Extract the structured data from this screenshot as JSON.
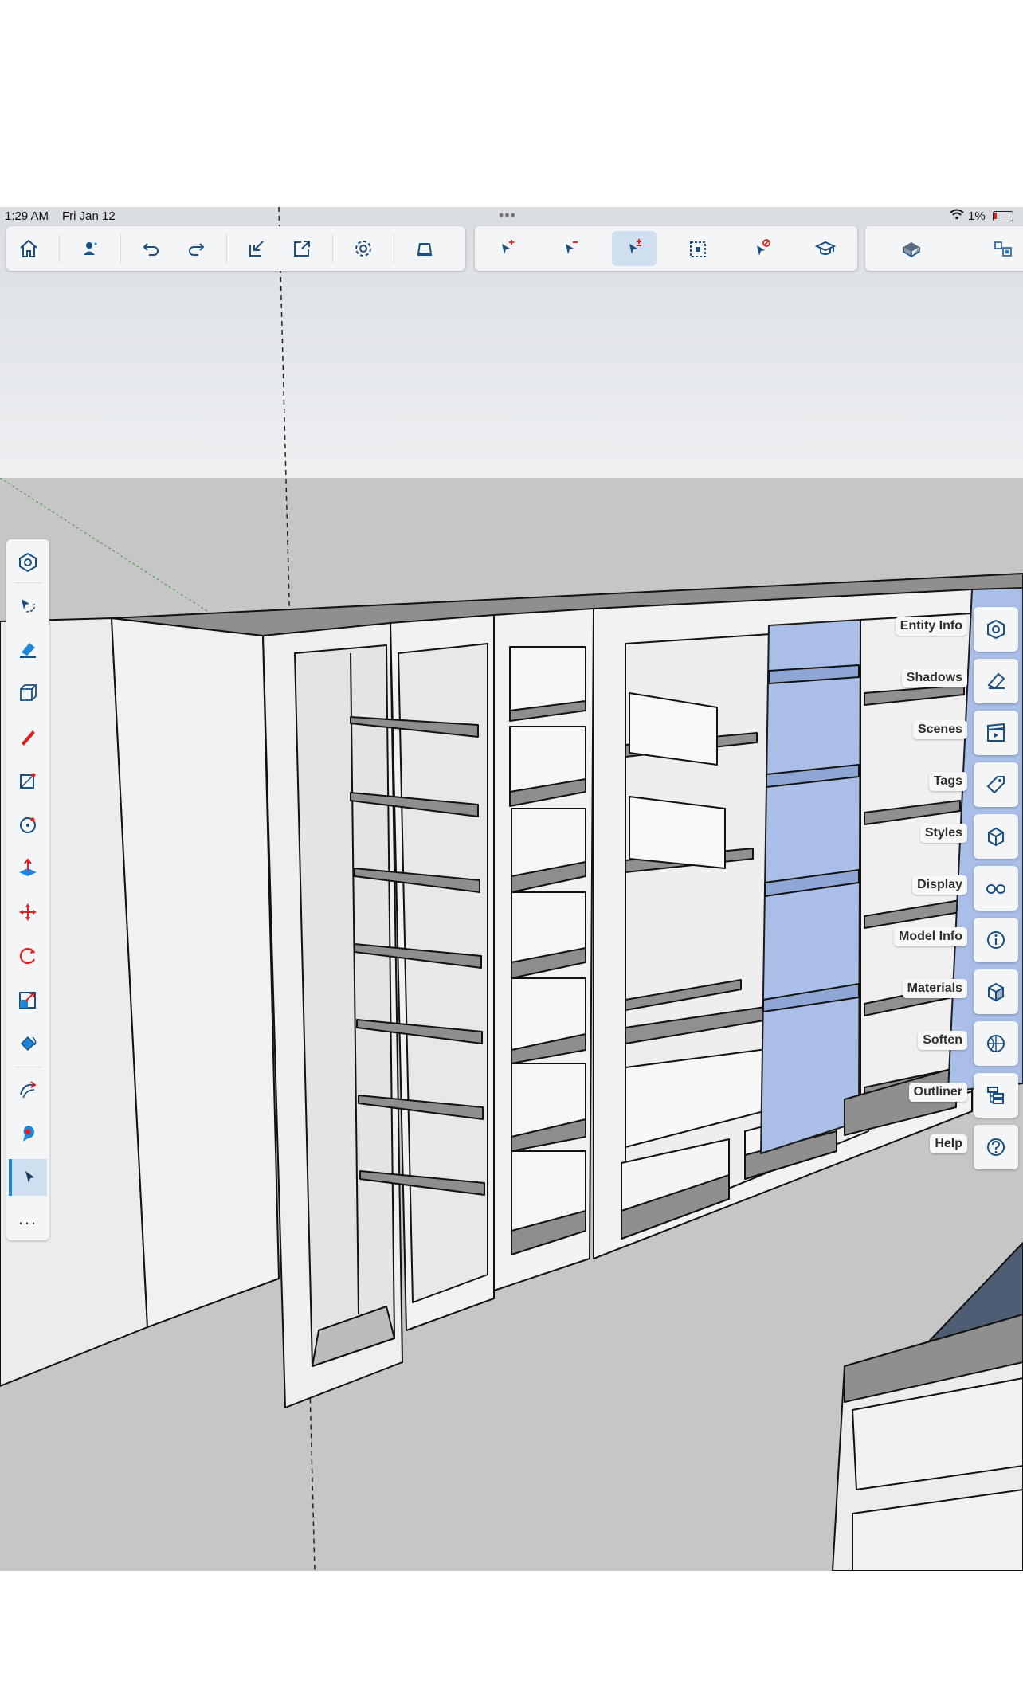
{
  "status_bar": {
    "time": "1:29 AM",
    "date": "Fri Jan 12",
    "battery": "1%"
  },
  "toolbar": {
    "group1": [
      {
        "name": "home-button",
        "icon": "home-icon"
      },
      {
        "name": "account-button",
        "icon": "user-icon"
      },
      {
        "name": "undo-button",
        "icon": "undo-icon"
      },
      {
        "name": "redo-button",
        "icon": "redo-icon"
      },
      {
        "name": "import-button",
        "icon": "import-icon"
      },
      {
        "name": "export-button",
        "icon": "export-icon"
      },
      {
        "name": "settings-button",
        "icon": "gear-icon"
      },
      {
        "name": "ar-button",
        "icon": "ar-viewer-icon"
      }
    ],
    "group2": [
      {
        "name": "select-add-button",
        "icon": "select-add-icon"
      },
      {
        "name": "select-subtract-button",
        "icon": "select-subtract-icon"
      },
      {
        "name": "select-toggle-button",
        "icon": "select-toggle-icon",
        "active": true
      },
      {
        "name": "select-all-button",
        "icon": "select-all-icon"
      },
      {
        "name": "select-none-button",
        "icon": "select-none-icon"
      },
      {
        "name": "instructor-button",
        "icon": "graduation-cap-icon"
      }
    ],
    "group3": [
      {
        "name": "make-group-button",
        "icon": "group-icon"
      },
      {
        "name": "make-component-button",
        "icon": "component-icon"
      }
    ]
  },
  "left_tools": [
    {
      "name": "search-3d-warehouse-tool",
      "icon": "hexagon-icon"
    },
    {
      "name": "lasso-select-tool",
      "icon": "lasso-icon"
    },
    {
      "name": "eraser-tool",
      "icon": "eraser-icon"
    },
    {
      "name": "view-tool",
      "icon": "cube-view-icon"
    },
    {
      "name": "line-tool",
      "icon": "pencil-icon"
    },
    {
      "name": "rectangle-tool",
      "icon": "rectangle-icon"
    },
    {
      "name": "circle-tool",
      "icon": "circle-icon"
    },
    {
      "name": "push-pull-tool",
      "icon": "push-pull-icon"
    },
    {
      "name": "move-tool",
      "icon": "move-icon"
    },
    {
      "name": "rotate-tool",
      "icon": "rotate-icon"
    },
    {
      "name": "scale-tool",
      "icon": "scale-icon"
    },
    {
      "name": "paint-bucket-tool",
      "icon": "paint-bucket-icon"
    },
    {
      "name": "orbit-tool",
      "icon": "orbit-icon"
    },
    {
      "name": "tape-measure-tool",
      "icon": "tape-measure-icon"
    },
    {
      "name": "select-tool",
      "icon": "arrow-cursor-icon",
      "active": true
    },
    {
      "name": "more-tools",
      "icon": "ellipsis-icon",
      "label": "..."
    }
  ],
  "right_panel": [
    {
      "label": "Entity Info",
      "icon": "entity-info-icon"
    },
    {
      "label": "Shadows",
      "icon": "shadows-icon"
    },
    {
      "label": "Scenes",
      "icon": "scenes-icon"
    },
    {
      "label": "Tags",
      "icon": "tag-icon"
    },
    {
      "label": "Styles",
      "icon": "styles-icon"
    },
    {
      "label": "Display",
      "icon": "glasses-icon"
    },
    {
      "label": "Model Info",
      "icon": "info-icon"
    },
    {
      "label": "Materials",
      "icon": "materials-icon"
    },
    {
      "label": "Soften",
      "icon": "soften-icon"
    },
    {
      "label": "Outliner",
      "icon": "outliner-icon"
    },
    {
      "label": "Help",
      "icon": "help-icon"
    }
  ],
  "colors": {
    "accent": "#1e86d8",
    "selection_fill": "#a9bfe8",
    "toolbar_bg": "#f4f5f7",
    "icon_blue": "#1b4f80",
    "icon_red": "#e02020"
  }
}
